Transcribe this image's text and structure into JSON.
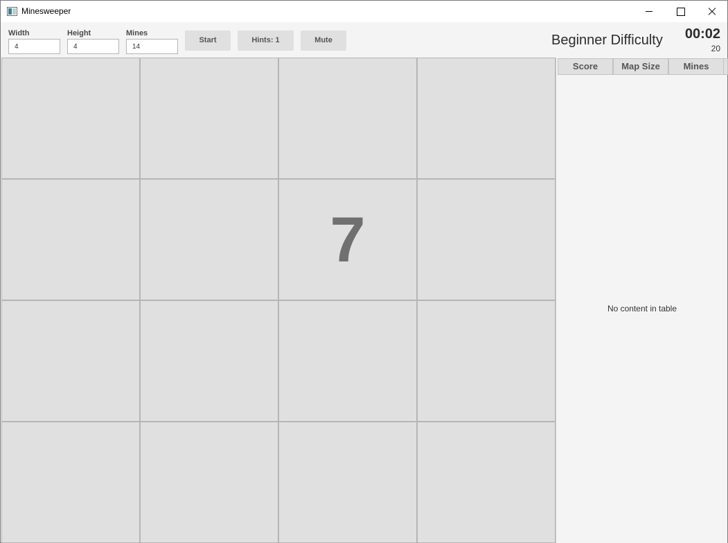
{
  "window": {
    "title": "Minesweeper"
  },
  "toolbar": {
    "width_label": "Width",
    "width_value": "4",
    "height_label": "Height",
    "height_value": "4",
    "mines_label": "Mines",
    "mines_value": "14",
    "start_label": "Start",
    "hints_label": "Hints: 1",
    "mute_label": "Mute"
  },
  "status": {
    "difficulty": "Beginner Difficulty",
    "timer": "00:02",
    "count": "20"
  },
  "board": {
    "rows": 4,
    "cols": 4,
    "cells": [
      [
        "",
        "",
        "",
        ""
      ],
      [
        "",
        "",
        "7",
        ""
      ],
      [
        "",
        "",
        "",
        ""
      ],
      [
        "",
        "",
        "",
        ""
      ]
    ]
  },
  "table": {
    "columns": [
      "Score",
      "Map Size",
      "Mines"
    ],
    "empty_text": "No content in table"
  },
  "colors": {
    "cell_bg": "#e0e0e0",
    "cell_border": "#b5b5b5",
    "number_color": "#707070"
  }
}
